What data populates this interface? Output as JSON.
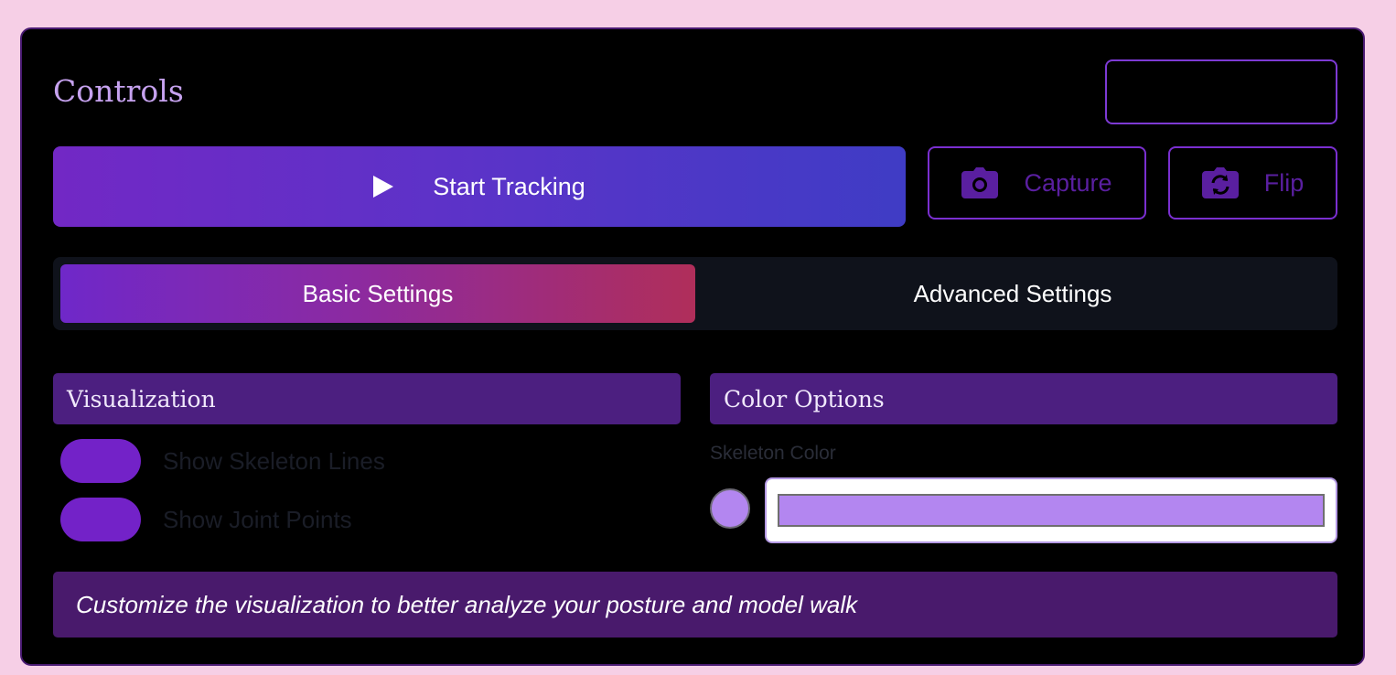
{
  "panel": {
    "title": "Controls"
  },
  "actions": {
    "start_label": "Start Tracking",
    "capture_label": "Capture",
    "flip_label": "Flip"
  },
  "tabs": [
    {
      "label": "Basic Settings",
      "active": true
    },
    {
      "label": "Advanced Settings",
      "active": false
    }
  ],
  "visualization": {
    "header": "Visualization",
    "toggles": [
      {
        "label": "Show Skeleton Lines",
        "on": true
      },
      {
        "label": "Show Joint Points",
        "on": true
      }
    ]
  },
  "color_options": {
    "header": "Color Options",
    "skeleton_color_label": "Skeleton Color",
    "skeleton_color_value": "#b386f0"
  },
  "info": {
    "text": "Customize the visualization to better analyze your posture and model walk"
  },
  "icons": {
    "start": "play-icon",
    "capture": "camera-icon",
    "flip": "camera-flip-icon"
  },
  "colors": {
    "accent": "#7322c8",
    "section_header": "#4c1f80",
    "page_bg": "#f6cfe6"
  }
}
